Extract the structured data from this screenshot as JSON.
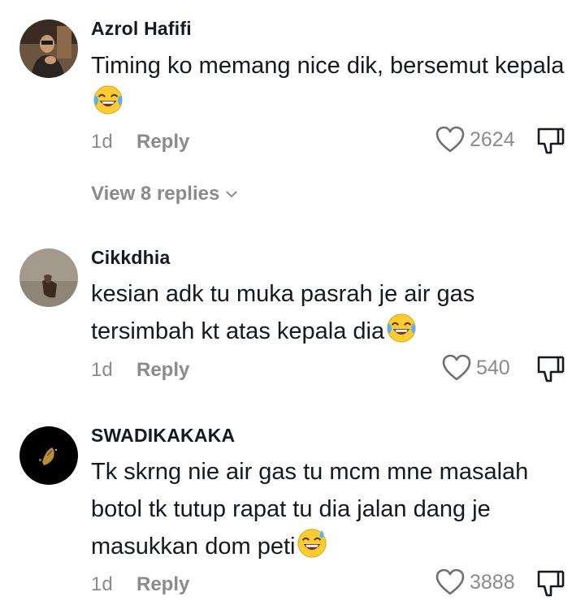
{
  "comments": [
    {
      "username": "Azrol Hafifi",
      "text": "Timing ko memang nice dik, bersemut kepala",
      "emoji": "laughing-tears-emoji",
      "time": "1d",
      "reply_label": "Reply",
      "likes": "2624",
      "view_replies": "View 8 replies"
    },
    {
      "username": "Cikkdhia",
      "text": "kesian adk tu muka pasrah je air gas tersimbah kt atas kepala dia",
      "emoji": "laughing-tears-emoji",
      "time": "1d",
      "reply_label": "Reply",
      "likes": "540"
    },
    {
      "username": "SWADIKAKAKA",
      "text": "Tk skrng nie air gas tu mcm mne masalah botol tk tutup rapat tu dia jalan dang je masukkan dom peti",
      "emoji": "sweat-smile-emoji",
      "time": "1d",
      "reply_label": "Reply",
      "likes": "3888"
    }
  ],
  "colors": {
    "text": "#161823",
    "muted": "#8a8b91"
  }
}
